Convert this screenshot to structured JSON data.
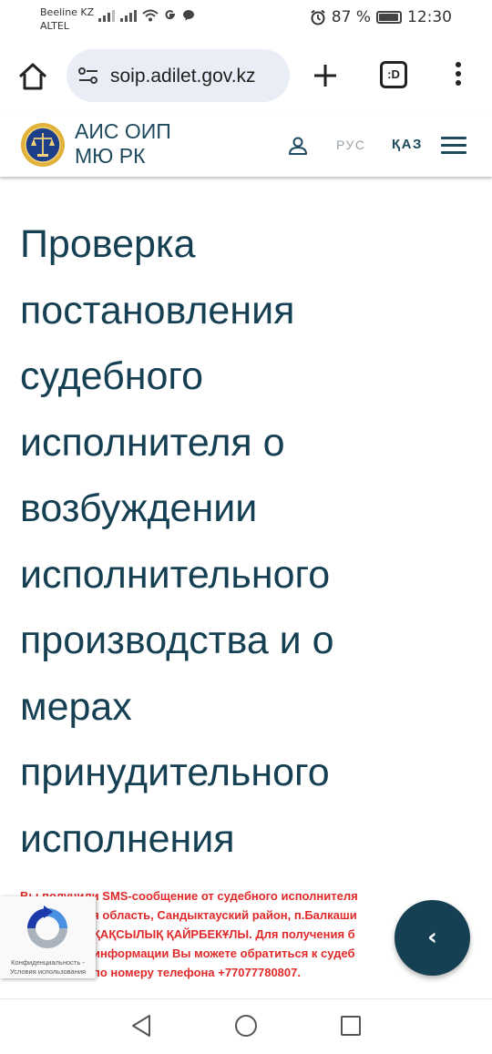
{
  "status_bar": {
    "carrier_1": "Beeline KZ",
    "carrier_2": "ALTEL",
    "battery": "87 %",
    "time": "12:30"
  },
  "browser": {
    "url": "soip.adilet.gov.kz",
    "tabs_label": ":D"
  },
  "site_header": {
    "title_line1": "АИС ОИП",
    "title_line2": "МЮ РК",
    "lang_ru": "РУС",
    "lang_kz": "ҚАЗ"
  },
  "main": {
    "title_lines": [
      "Проверка",
      "постановления",
      "судебного",
      "исполнителя о",
      "возбуждении",
      "исполнительного",
      "производства и о",
      "мерах",
      "принудительного",
      "исполнения"
    ],
    "sms_lines": [
      "Вы получили SMS-сообщение от судебного исполнителя",
      "ая область, Сандыктауский район, п.Балкаши",
      "ҚАҚСЫЛЫҚ ҚАЙРБЕКҰЛЫ. Для получения б",
      "информации Вы можете обратиться к судеб",
      "по номеру телефона +77077780807."
    ]
  },
  "recaptcha": {
    "line1": "Конфиденциальность -",
    "line2": "Условия использования"
  },
  "fab": {
    "icon": "‹"
  }
}
